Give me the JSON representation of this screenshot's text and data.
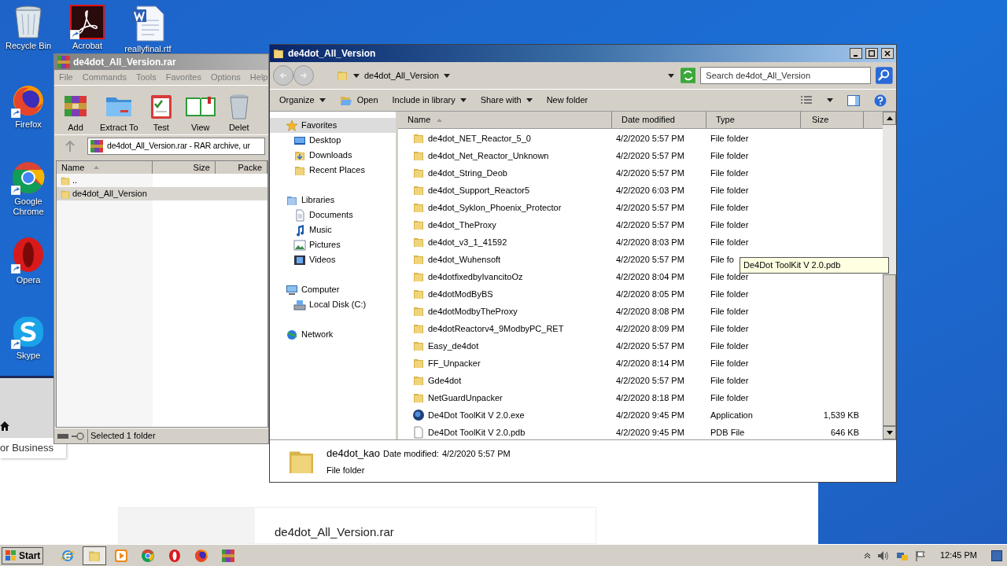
{
  "desktop_icons": [
    {
      "kind": "recycle",
      "label": "Recycle Bin"
    },
    {
      "kind": "acrobat",
      "label": "Acrobat"
    },
    {
      "kind": "word",
      "label": "reallyfinal.rtf"
    },
    {
      "kind": "firefox",
      "label": "Firefox"
    },
    {
      "kind": "chrome",
      "label": "Google Chrome"
    },
    {
      "kind": "opera",
      "label": "Opera"
    },
    {
      "kind": "skype",
      "label": "Skype"
    }
  ],
  "browser_page": {
    "side_text": "or Business",
    "card_title": "de4dot_All_Version.rar"
  },
  "winrar": {
    "title": "de4dot_All_Version.rar",
    "menu": [
      "File",
      "Commands",
      "Tools",
      "Favorites",
      "Options",
      "Help"
    ],
    "toolbar": [
      {
        "kind": "add",
        "label": "Add"
      },
      {
        "kind": "extract",
        "label": "Extract To"
      },
      {
        "kind": "test",
        "label": "Test"
      },
      {
        "kind": "view",
        "label": "View"
      },
      {
        "kind": "delete",
        "label": "Delet"
      }
    ],
    "address": "de4dot_All_Version.rar - RAR archive, ur",
    "columns": [
      "Name",
      "Size",
      "Packe"
    ],
    "rows": [
      {
        "name": "..",
        "selected": false
      },
      {
        "name": "de4dot_All_Version",
        "selected": true
      }
    ],
    "status": "Selected 1 folder"
  },
  "explorer": {
    "title": "de4dot_All_Version",
    "breadcrumb": "de4dot_All_Version",
    "search_placeholder": "Search de4dot_All_Version",
    "commands": [
      {
        "label": "Organize",
        "dropdown": true
      },
      {
        "label": "Open",
        "dropdown": false,
        "icon": true
      },
      {
        "label": "Include in library",
        "dropdown": true
      },
      {
        "label": "Share with",
        "dropdown": true
      },
      {
        "label": "New folder",
        "dropdown": false
      }
    ],
    "nav": [
      {
        "kind": "favorites",
        "label": "Favorites",
        "selected": true,
        "children": [
          {
            "kind": "desktop",
            "label": "Desktop",
            "selected": false
          },
          {
            "kind": "downloads",
            "label": "Downloads",
            "selected": false
          },
          {
            "kind": "recent",
            "label": "Recent Places",
            "selected": false
          }
        ]
      },
      {
        "kind": "libraries",
        "label": "Libraries",
        "selected": false,
        "children": [
          {
            "kind": "documents",
            "label": "Documents",
            "selected": false
          },
          {
            "kind": "music",
            "label": "Music",
            "selected": false
          },
          {
            "kind": "pictures",
            "label": "Pictures",
            "selected": false
          },
          {
            "kind": "videos",
            "label": "Videos",
            "selected": false
          }
        ]
      },
      {
        "kind": "computer",
        "label": "Computer",
        "selected": false,
        "children": [
          {
            "kind": "disk",
            "label": "Local Disk (C:)",
            "selected": false
          }
        ]
      },
      {
        "kind": "network",
        "label": "Network",
        "selected": false
      }
    ],
    "columns": [
      "Name",
      "Date modified",
      "Type",
      "Size"
    ],
    "files": [
      {
        "kind": "folder",
        "name": "de4dot_NET_Reactor_5_0",
        "date": "4/2/2020 5:57 PM",
        "type": "File folder"
      },
      {
        "kind": "folder",
        "name": "de4dot_Net_Reactor_Unknown",
        "date": "4/2/2020 5:57 PM",
        "type": "File folder"
      },
      {
        "kind": "folder",
        "name": "de4dot_String_Deob",
        "date": "4/2/2020 5:57 PM",
        "type": "File folder"
      },
      {
        "kind": "folder",
        "name": "de4dot_Support_Reactor5",
        "date": "4/2/2020 6:03 PM",
        "type": "File folder"
      },
      {
        "kind": "folder",
        "name": "de4dot_Syklon_Phoenix_Protector",
        "date": "4/2/2020 5:57 PM",
        "type": "File folder"
      },
      {
        "kind": "folder",
        "name": "de4dot_TheProxy",
        "date": "4/2/2020 5:57 PM",
        "type": "File folder"
      },
      {
        "kind": "folder",
        "name": "de4dot_v3_1_41592",
        "date": "4/2/2020 8:03 PM",
        "type": "File folder"
      },
      {
        "kind": "folder",
        "name": "de4dot_Wuhensoft",
        "date": "4/2/2020 5:57 PM",
        "type": "File fo"
      },
      {
        "kind": "folder",
        "name": "de4dotfixedbyIvancitoOz",
        "date": "4/2/2020 8:04 PM",
        "type": "File folder"
      },
      {
        "kind": "folder",
        "name": "de4dotModByBS",
        "date": "4/2/2020 8:05 PM",
        "type": "File folder"
      },
      {
        "kind": "folder",
        "name": "de4dotModbyTheProxy",
        "date": "4/2/2020 8:08 PM",
        "type": "File folder"
      },
      {
        "kind": "folder",
        "name": "de4dotReactorv4_9ModbyPC_RET",
        "date": "4/2/2020 8:09 PM",
        "type": "File folder"
      },
      {
        "kind": "folder",
        "name": "Easy_de4dot",
        "date": "4/2/2020 5:57 PM",
        "type": "File folder"
      },
      {
        "kind": "folder",
        "name": "FF_Unpacker",
        "date": "4/2/2020 8:14 PM",
        "type": "File folder"
      },
      {
        "kind": "folder",
        "name": "Gde4dot",
        "date": "4/2/2020 5:57 PM",
        "type": "File folder"
      },
      {
        "kind": "folder",
        "name": "NetGuardUnpacker",
        "date": "4/2/2020 8:18 PM",
        "type": "File folder"
      },
      {
        "kind": "app",
        "name": "De4Dot ToolKit V 2.0.exe",
        "date": "4/2/2020 9:45 PM",
        "type": "Application",
        "size": "1,539 KB"
      },
      {
        "kind": "file",
        "name": "De4Dot ToolKit V 2.0.pdb",
        "date": "4/2/2020 9:45 PM",
        "type": "PDB File",
        "size": "646 KB"
      }
    ],
    "tooltip": "De4Dot ToolKit V 2.0.pdb",
    "details": {
      "name": "de4dot_kao",
      "date_label": "Date modified:",
      "date": "4/2/2020 5:57 PM",
      "type": "File folder"
    }
  },
  "taskbar": {
    "start": "Start",
    "apps": [
      {
        "kind": "ie",
        "active": false
      },
      {
        "kind": "explorer",
        "active": true
      },
      {
        "kind": "media",
        "active": false
      },
      {
        "kind": "chrome",
        "active": false
      },
      {
        "kind": "opera",
        "active": false
      },
      {
        "kind": "firefox",
        "active": false
      },
      {
        "kind": "winrar",
        "active": false
      }
    ],
    "clock": "12:45 PM"
  }
}
